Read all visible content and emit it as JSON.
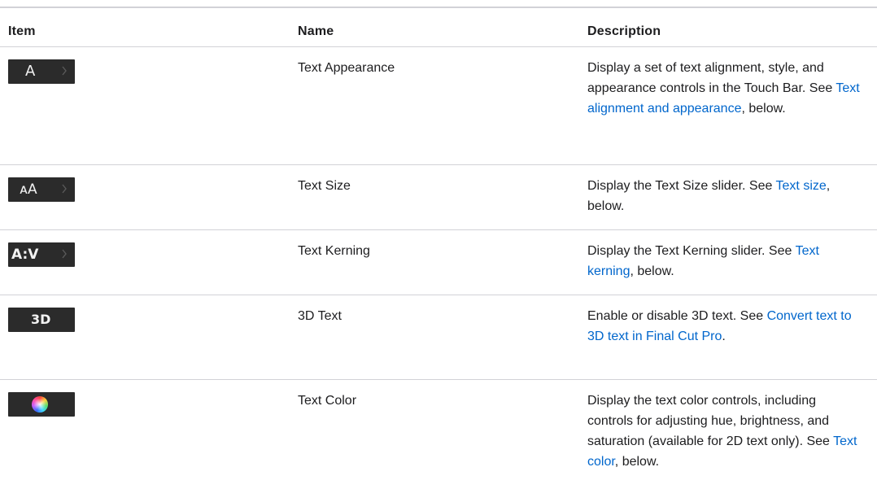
{
  "headers": {
    "item": "Item",
    "name": "Name",
    "description": "Description"
  },
  "rows": [
    {
      "icon": "text-appearance-icon",
      "glyph": "A",
      "has_chevron": true,
      "name": "Text Appearance",
      "desc_before": "Display a set of text alignment, style, and appearance controls in the Touch Bar. See ",
      "link": "Text alignment and appearance",
      "desc_after": ", below."
    },
    {
      "icon": "text-size-icon",
      "glyph": "ᴀA",
      "has_chevron": true,
      "name": "Text Size",
      "desc_before": "Display the Text Size slider. See ",
      "link": "Text size",
      "desc_after": ", below."
    },
    {
      "icon": "text-kerning-icon",
      "glyph": "A:V",
      "has_chevron": true,
      "name": "Text Kerning",
      "desc_before": "Display the Text Kerning slider. See ",
      "link": "Text kerning",
      "desc_after": ", below."
    },
    {
      "icon": "3d-text-icon",
      "glyph": "3D",
      "has_chevron": false,
      "name": "3D Text",
      "desc_before": "Enable or disable 3D text. See ",
      "link": "Convert text to 3D text in Final Cut Pro",
      "desc_after": "."
    },
    {
      "icon": "color-wheel-icon",
      "glyph": "",
      "has_chevron": false,
      "name": "Text Color",
      "desc_before": "Display the text color controls, including controls for adjusting hue, brightness, and saturation (available for 2D text only). See ",
      "link": "Text color",
      "desc_after": ", below."
    }
  ],
  "colors": {
    "link": "#0066cc",
    "touchbar_bg": "#2b2b2b",
    "divider": "#d2d2d7"
  }
}
